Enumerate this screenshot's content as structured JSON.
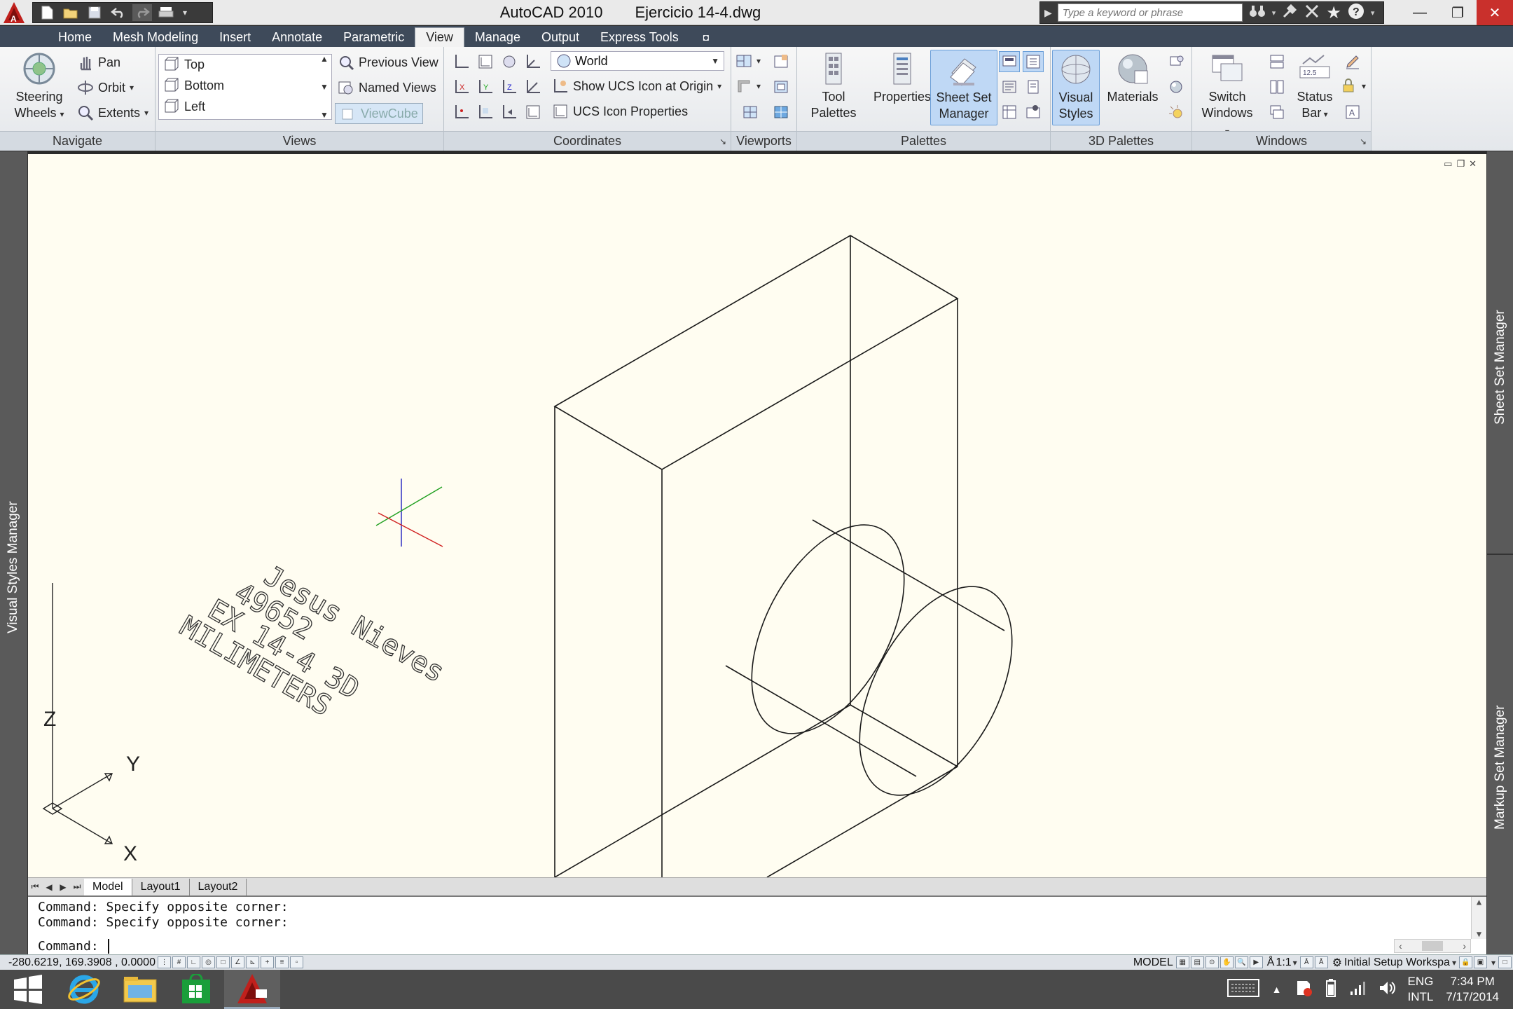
{
  "app": {
    "name": "AutoCAD 2010",
    "file": "Ejercicio 14-4.dwg",
    "search_placeholder": "Type a keyword or phrase"
  },
  "tabs": [
    "Home",
    "Mesh Modeling",
    "Insert",
    "Annotate",
    "Parametric",
    "View",
    "Manage",
    "Output",
    "Express Tools"
  ],
  "active_tab": "View",
  "ribbon": {
    "navigate": {
      "title": "Navigate",
      "steering_line1": "Steering",
      "steering_line2": "Wheels",
      "pan": "Pan",
      "orbit": "Orbit",
      "extents": "Extents"
    },
    "views": {
      "title": "Views",
      "list": [
        "Top",
        "Bottom",
        "Left"
      ],
      "previous_view": "Previous View",
      "named_views": "Named Views",
      "viewcube": "ViewCube"
    },
    "coordinates": {
      "title": "Coordinates",
      "ucs_select": "World",
      "show_ucs_icon": "Show UCS Icon at Origin",
      "ucs_icon_properties": "UCS Icon Properties"
    },
    "viewports": {
      "title": "Viewports"
    },
    "palettes": {
      "title": "Palettes",
      "tool_line1": "Tool",
      "tool_line2": "Palettes",
      "properties": "Properties",
      "ssm_line1": "Sheet Set",
      "ssm_line2": "Manager"
    },
    "palettes3d": {
      "title": "3D Palettes",
      "vs_line1": "Visual",
      "vs_line2": "Styles",
      "materials": "Materials"
    },
    "windows": {
      "title": "Windows",
      "sw_line1": "Switch",
      "sw_line2": "Windows",
      "sb_line1": "Status",
      "sb_line2": "Bar"
    }
  },
  "side_palettes": {
    "left": "Visual Styles Manager",
    "right_top": "Sheet Set Manager",
    "right_bottom": "Markup Set Manager"
  },
  "drawing": {
    "annotation": [
      "Jesus Nieves",
      "49652",
      "EX 14-4 3D",
      "MILIMETERS"
    ],
    "ucs_axes": [
      "X",
      "Y",
      "Z"
    ]
  },
  "layout_tabs": [
    "Model",
    "Layout1",
    "Layout2"
  ],
  "active_layout": "Model",
  "command": {
    "history": [
      "Command: Specify opposite corner:",
      "Command: Specify opposite corner:"
    ],
    "prompt": "Command: "
  },
  "status": {
    "coords": "-280.6219, 169.3908 , 0.0000",
    "space": "MODEL",
    "scale": "1:1",
    "workspace": "Initial Setup Workspa"
  },
  "taskbar": {
    "lang_line1": "ENG",
    "lang_line2": "INTL",
    "time": "7:34 PM",
    "date": "7/17/2014"
  },
  "colors": {
    "canvas": "#fffdf1",
    "ribbon_tabs": "#3e4a5a",
    "selected": "#bfd8f5",
    "axis_x": "#d02020",
    "axis_y": "#20a020",
    "axis_z": "#2020c0"
  }
}
